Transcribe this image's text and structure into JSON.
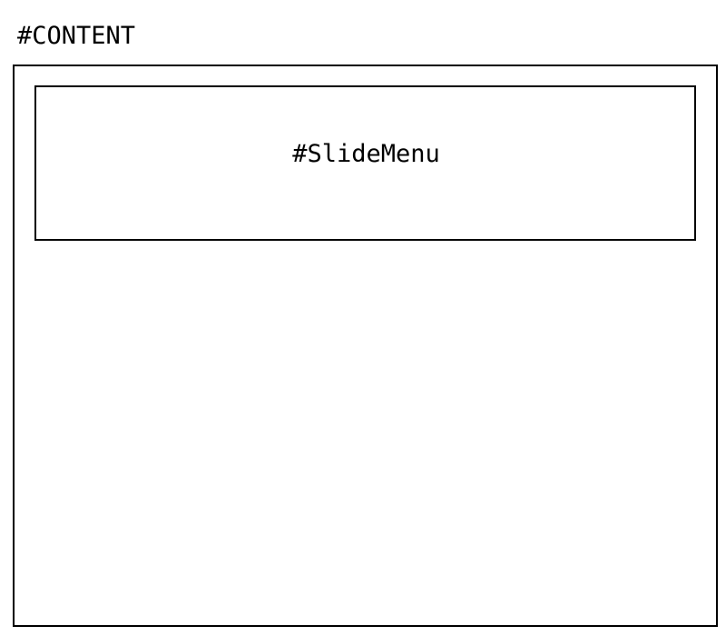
{
  "content": {
    "label": "#CONTENT",
    "slide_menu": {
      "label": "#SlideMenu"
    }
  },
  "colors": {
    "stroke": "#000000",
    "background": "#ffffff"
  }
}
